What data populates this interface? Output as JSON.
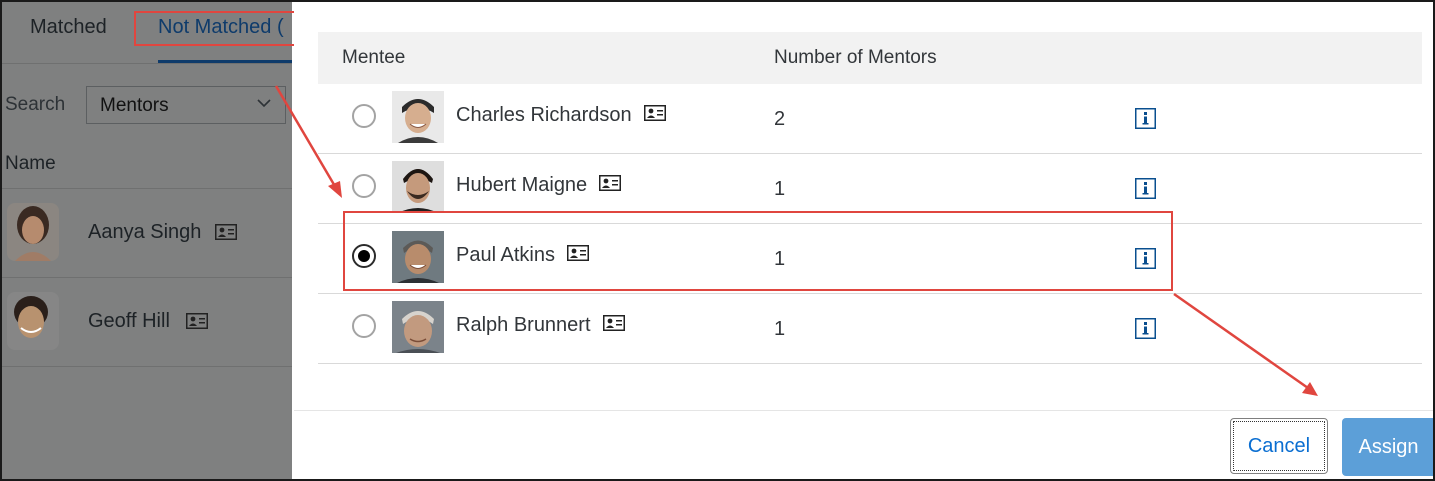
{
  "background_page": {
    "tabs": [
      {
        "label": "Matched"
      },
      {
        "label": "Not Matched ("
      }
    ],
    "search_label": "Search",
    "search_select_value": "Mentors",
    "column_header": "Name",
    "rows": [
      {
        "name": "Aanya Singh"
      },
      {
        "name": "Geoff Hill"
      }
    ]
  },
  "dialog": {
    "columns": {
      "mentee": "Mentee",
      "number_of_mentors": "Number of Mentors"
    },
    "rows": [
      {
        "name": "Charles Richardson",
        "mentors": "2",
        "selected": false
      },
      {
        "name": "Hubert Maigne",
        "mentors": "1",
        "selected": false
      },
      {
        "name": "Paul Atkins",
        "mentors": "1",
        "selected": true
      },
      {
        "name": "Ralph Brunnert",
        "mentors": "1",
        "selected": false
      }
    ],
    "buttons": {
      "cancel": "Cancel",
      "assign": "Assign"
    }
  },
  "colors": {
    "accent": "#0a6ed1",
    "assign_button": "#5c9fd8",
    "annotation": "#e0463f",
    "info_icon": "#0a4f8f"
  },
  "icons": {
    "contact_card": "contact-card-icon",
    "info": "info-icon",
    "chevron": "chevron-down-icon"
  }
}
